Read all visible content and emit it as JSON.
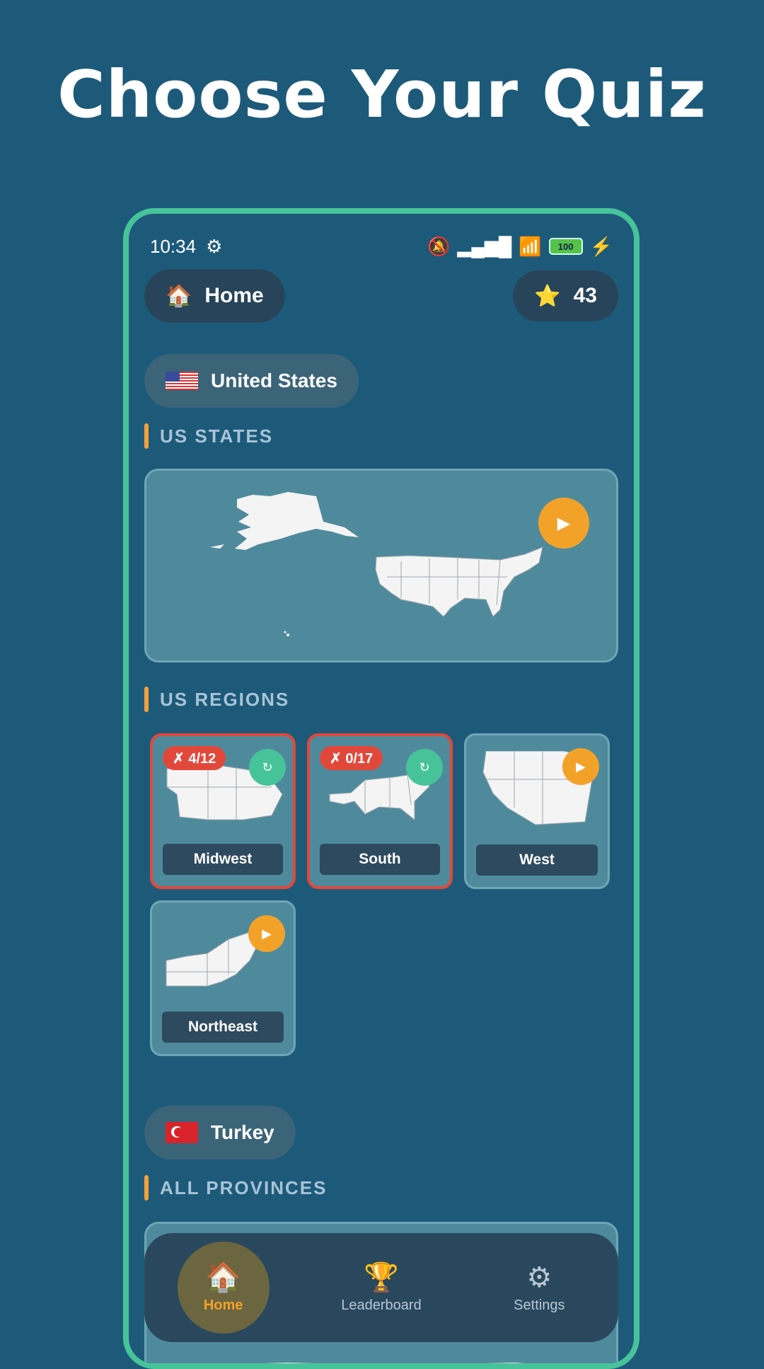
{
  "headline": "Choose Your Quiz",
  "status": {
    "time": "10:34",
    "battery": "100"
  },
  "header": {
    "home_label": "Home",
    "stars": "43"
  },
  "us": {
    "country": "United States",
    "states_section": "US STATES",
    "regions_section": "US REGIONS",
    "regions": [
      {
        "name": "Midwest",
        "badge": "✗ 4/12",
        "action": "↻"
      },
      {
        "name": "South",
        "badge": "✗ 0/17",
        "action": "↻"
      },
      {
        "name": "West",
        "action": "▶"
      },
      {
        "name": "Northeast",
        "action": "▶"
      }
    ]
  },
  "turkey": {
    "country": "Turkey",
    "section": "ALL PROVINCES"
  },
  "nav": [
    {
      "label": "Home",
      "icon": "house-icon"
    },
    {
      "label": "Leaderboard",
      "icon": "trophy-icon"
    },
    {
      "label": "Settings",
      "icon": "gear-icon"
    }
  ],
  "colors": {
    "background": "#1d5a7a",
    "accent": "#f3a229",
    "frame": "#47c39a",
    "error": "#e2483a"
  }
}
